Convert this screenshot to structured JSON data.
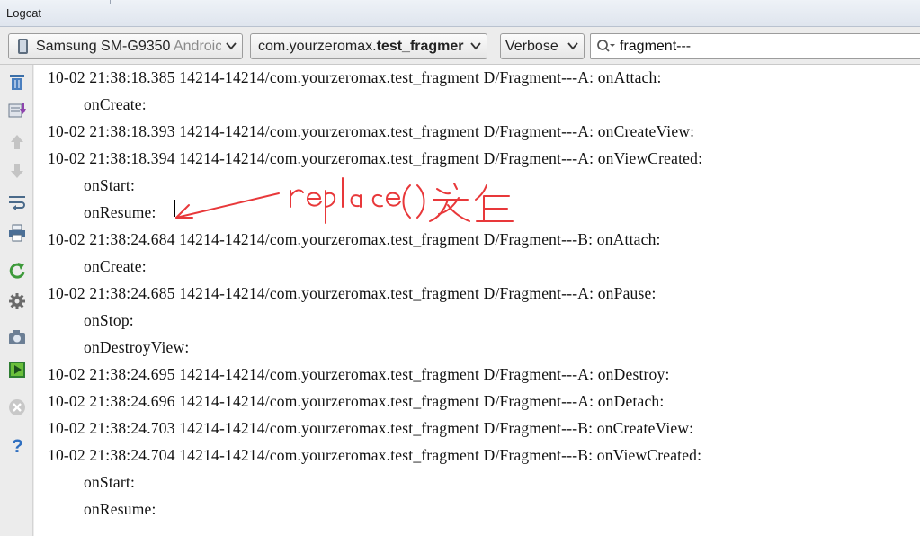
{
  "window": {
    "title": "Logcat"
  },
  "toolbar": {
    "device": {
      "name": "Samsung SM-G9350",
      "suffix": "Androic"
    },
    "process": {
      "prefix": "com.yourzeromax.",
      "bold": "test_fragmer"
    },
    "level": "Verbose",
    "search_value": "fragment---"
  },
  "sidebar": {
    "icons": [
      "trash-icon",
      "scroll-to-end-icon",
      "arrow-up-icon",
      "arrow-down-icon",
      "soft-wrap-icon",
      "print-icon",
      "restart-icon",
      "settings-icon",
      "screenshot-icon",
      "screen-record-icon",
      "close-icon",
      "help-icon"
    ]
  },
  "log": {
    "lines": [
      {
        "text": "10-02 21:38:18.385 14214-14214/com.yourzeromax.test_fragment D/Fragment---A: onAttach:",
        "cont": false
      },
      {
        "text": "onCreate:",
        "cont": true
      },
      {
        "text": "10-02 21:38:18.393 14214-14214/com.yourzeromax.test_fragment D/Fragment---A: onCreateView:",
        "cont": false
      },
      {
        "text": "10-02 21:38:18.394 14214-14214/com.yourzeromax.test_fragment D/Fragment---A: onViewCreated:",
        "cont": false
      },
      {
        "text": "onStart:",
        "cont": true
      },
      {
        "text": "onResume:",
        "cont": true
      },
      {
        "text": "10-02 21:38:24.684 14214-14214/com.yourzeromax.test_fragment D/Fragment---B: onAttach:",
        "cont": false
      },
      {
        "text": "onCreate:",
        "cont": true
      },
      {
        "text": "10-02 21:38:24.685 14214-14214/com.yourzeromax.test_fragment D/Fragment---A: onPause:",
        "cont": false
      },
      {
        "text": "onStop:",
        "cont": true
      },
      {
        "text": "onDestroyView:",
        "cont": true
      },
      {
        "text": "10-02 21:38:24.695 14214-14214/com.yourzeromax.test_fragment D/Fragment---A: onDestroy:",
        "cont": false
      },
      {
        "text": "10-02 21:38:24.696 14214-14214/com.yourzeromax.test_fragment D/Fragment---A: onDetach:",
        "cont": false
      },
      {
        "text": "10-02 21:38:24.703 14214-14214/com.yourzeromax.test_fragment D/Fragment---B: onCreateView:",
        "cont": false
      },
      {
        "text": "10-02 21:38:24.704 14214-14214/com.yourzeromax.test_fragment D/Fragment---B: onViewCreated:",
        "cont": false
      },
      {
        "text": "onStart:",
        "cont": true
      },
      {
        "text": "onResume:",
        "cont": true
      }
    ]
  },
  "annotation": {
    "text": "replace()发生",
    "color": "#e8383a"
  }
}
